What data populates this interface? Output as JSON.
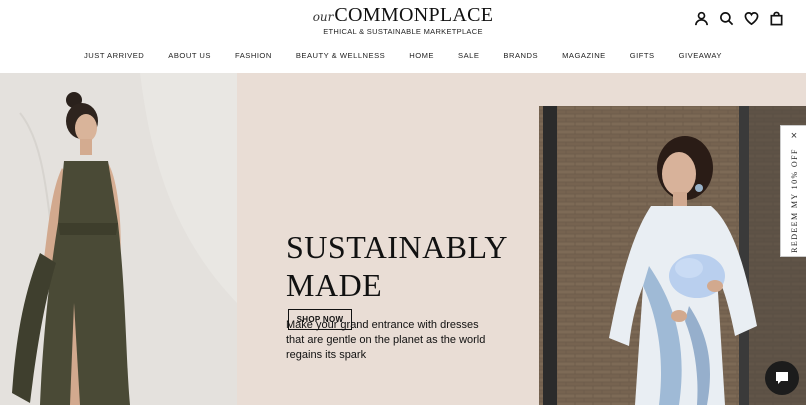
{
  "header": {
    "logo_script": "our",
    "logo_main": "COMMONPLACE",
    "tagline": "ETHICAL & SUSTAINABLE MARKETPLACE",
    "icons": [
      "account-icon",
      "search-icon",
      "heart-icon",
      "bag-icon"
    ]
  },
  "nav": {
    "items": [
      "JUST ARRIVED",
      "ABOUT US",
      "FASHION",
      "BEAUTY & WELLNESS",
      "HOME",
      "SALE",
      "BRANDS",
      "MAGAZINE",
      "GIFTS",
      "GIVEAWAY"
    ]
  },
  "hero": {
    "title_line1": "SUSTAINABLY",
    "title_line2": "MADE",
    "body": "Make your grand entrance with dresses that are gentle on the planet as the world regains its spark",
    "button": "SHOP NOW",
    "background_color": "#e9ddd5"
  },
  "promo_tab": {
    "label": "REDEEM MY 10% OFF",
    "close": "×"
  }
}
